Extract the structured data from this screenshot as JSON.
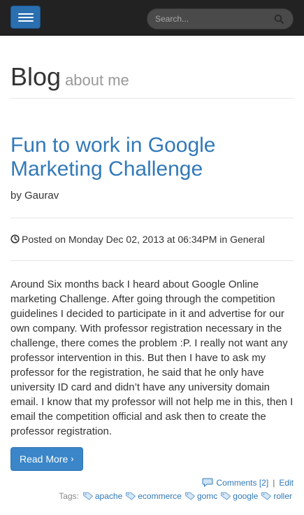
{
  "navbar": {
    "search_placeholder": "Search..."
  },
  "header": {
    "title": "Blog",
    "subtitle": "about me"
  },
  "post": {
    "title": "Fun to work in Google Marketing Challenge",
    "byline": "by Gaurav",
    "meta": "Posted on Monday Dec 02, 2013 at 06:34PM in General",
    "content": "Around Six months back I heard about Google Online marketing Challenge. After going through the competition guidelines I decided to participate in it and advertise for our own company. With professor registration necessary in the challenge, there comes the problem :P. I really not want any professor intervention in this. But then I have to ask my professor for the registration, he said that he only have university ID card and didn’t have any university domain email. I know that my professor will not help me in this, then I email the competition official and ask then to create the professor registration.",
    "read_more": "Read More",
    "comments": "Comments [2]",
    "separator": "|",
    "edit": "Edit",
    "tags_label": "Tags:",
    "tags": [
      "apache",
      "ecommerce",
      "gomc",
      "google",
      "roller"
    ]
  },
  "colors": {
    "accent": "#3279b8",
    "navbar_bg": "#222222",
    "button_bg": "#3a86c8"
  },
  "icons": {
    "menu": "hamburger-icon",
    "search": "search-icon",
    "clock": "clock-icon",
    "comment": "comment-icon",
    "tag": "tag-icon",
    "chevron": "chevron-right-icon"
  }
}
